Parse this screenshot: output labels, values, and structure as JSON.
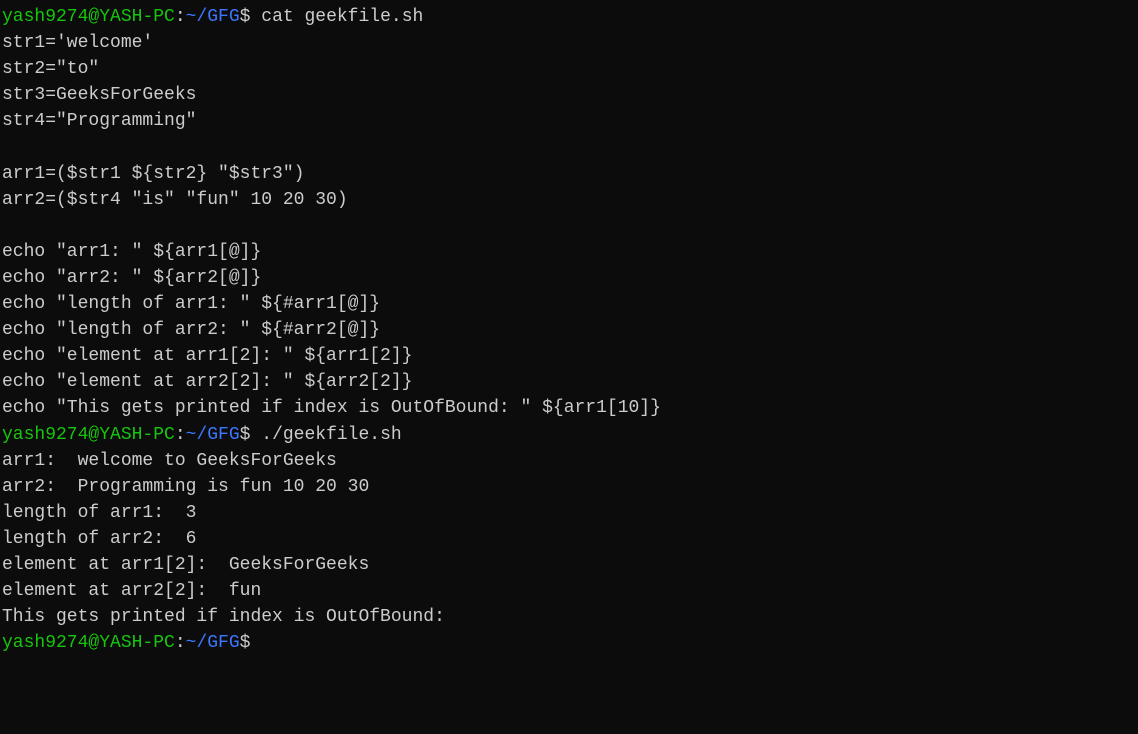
{
  "prompt1": {
    "user": "yash9274@YASH-PC",
    "colon": ":",
    "path": "~/GFG",
    "dollar": "$ ",
    "cmd": "cat geekfile.sh"
  },
  "file": {
    "l1": "str1='welcome'",
    "l2": "str2=\"to\"",
    "l3": "str3=GeeksForGeeks",
    "l4": "str4=\"Programming\"",
    "l5": "",
    "l6": "arr1=($str1 ${str2} \"$str3\")",
    "l7": "arr2=($str4 \"is\" \"fun\" 10 20 30)",
    "l8": "",
    "l9": "echo \"arr1: \" ${arr1[@]}",
    "l10": "echo \"arr2: \" ${arr2[@]}",
    "l11": "echo \"length of arr1: \" ${#arr1[@]}",
    "l12": "echo \"length of arr2: \" ${#arr2[@]}",
    "l13": "echo \"element at arr1[2]: \" ${arr1[2]}",
    "l14": "echo \"element at arr2[2]: \" ${arr2[2]}",
    "l15": "echo \"This gets printed if index is OutOfBound: \" ${arr1[10]}"
  },
  "prompt2": {
    "user": "yash9274@YASH-PC",
    "colon": ":",
    "path": "~/GFG",
    "dollar": "$ ",
    "cmd": "./geekfile.sh"
  },
  "out": {
    "l1": "arr1:  welcome to GeeksForGeeks",
    "l2": "arr2:  Programming is fun 10 20 30",
    "l3": "length of arr1:  3",
    "l4": "length of arr2:  6",
    "l5": "element at arr1[2]:  GeeksForGeeks",
    "l6": "element at arr2[2]:  fun",
    "l7": "This gets printed if index is OutOfBound:"
  },
  "prompt3": {
    "user": "yash9274@YASH-PC",
    "colon": ":",
    "path": "~/GFG",
    "dollar": "$"
  }
}
